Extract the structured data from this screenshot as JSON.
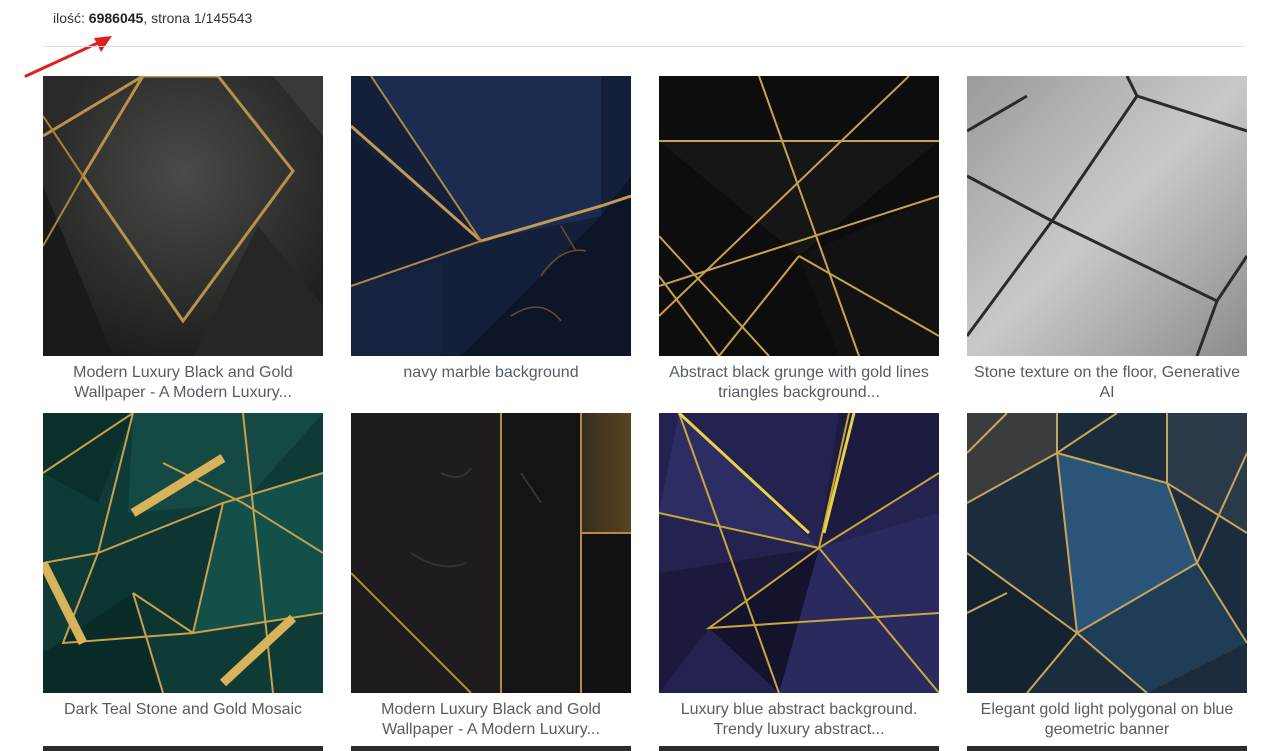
{
  "results": {
    "count_label": "ilość: ",
    "count": "6986045",
    "page_label": ", strona 1/145543"
  },
  "colors": {
    "arrow": "#e02020",
    "caption": "#555c66",
    "divider": "#dcdcdc"
  },
  "items": [
    {
      "title": "Modern Luxury Black and Gold Wallpaper - A Modern Luxury..."
    },
    {
      "title": "navy marble background"
    },
    {
      "title": "Abstract black grunge with gold lines triangles background..."
    },
    {
      "title": "Stone texture on the floor, Generative AI"
    },
    {
      "title": "Dark Teal Stone and Gold Mosaic"
    },
    {
      "title": "Modern Luxury Black and Gold Wallpaper - A Modern Luxury..."
    },
    {
      "title": "Luxury blue abstract background. Trendy luxury abstract..."
    },
    {
      "title": "Elegant gold light polygonal on blue geometric banner"
    }
  ]
}
